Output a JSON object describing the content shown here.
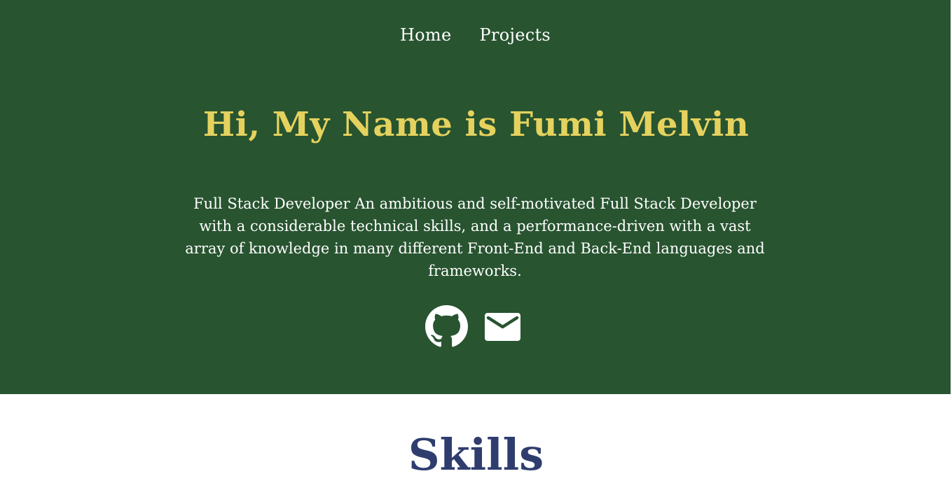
{
  "nav": {
    "items": [
      {
        "label": "Home"
      },
      {
        "label": "Projects"
      }
    ]
  },
  "hero": {
    "title": "Hi, My Name is Fumi Melvin",
    "description": "Full Stack Developer An ambitious and self-motivated Full Stack Developer with a considerable technical skills, and a performance-driven with a vast array of knowledge in many different Front-End and Back-End languages and frameworks.",
    "social": [
      {
        "icon": "github-icon"
      },
      {
        "icon": "mail-icon"
      }
    ]
  },
  "skills": {
    "title": "Skills"
  },
  "colors": {
    "hero_background": "#285430",
    "title_accent": "#E5D25E",
    "skills_heading": "#2F3D6E"
  }
}
